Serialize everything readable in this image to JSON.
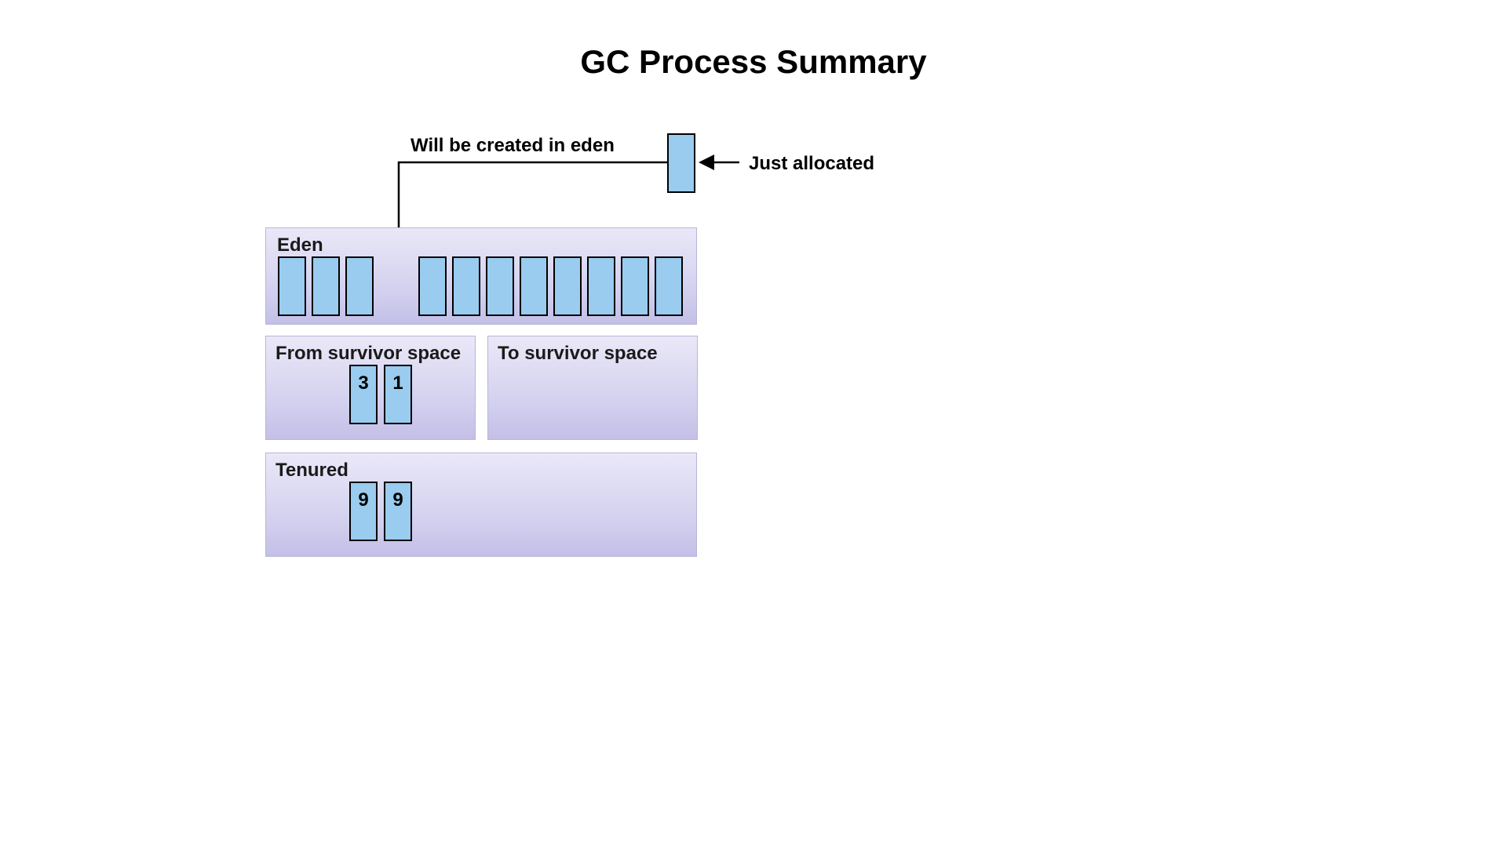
{
  "title": "GC Process Summary",
  "captions": {
    "created_in_eden": "Will be created in eden",
    "just_allocated": "Just allocated"
  },
  "regions": {
    "eden": {
      "label": "Eden"
    },
    "from": {
      "label": "From survivor space"
    },
    "to": {
      "label": "To survivor space"
    },
    "tenured": {
      "label": "Tenured"
    }
  },
  "objects": {
    "allocated": {
      "value": ""
    },
    "eden": [
      {
        "value": ""
      },
      {
        "value": ""
      },
      {
        "value": ""
      },
      {
        "value": ""
      },
      {
        "value": ""
      },
      {
        "value": ""
      },
      {
        "value": ""
      },
      {
        "value": ""
      },
      {
        "value": ""
      },
      {
        "value": ""
      },
      {
        "value": ""
      }
    ],
    "from": [
      {
        "value": "3"
      },
      {
        "value": "1"
      }
    ],
    "tenured": [
      {
        "value": "9"
      },
      {
        "value": "9"
      }
    ]
  }
}
